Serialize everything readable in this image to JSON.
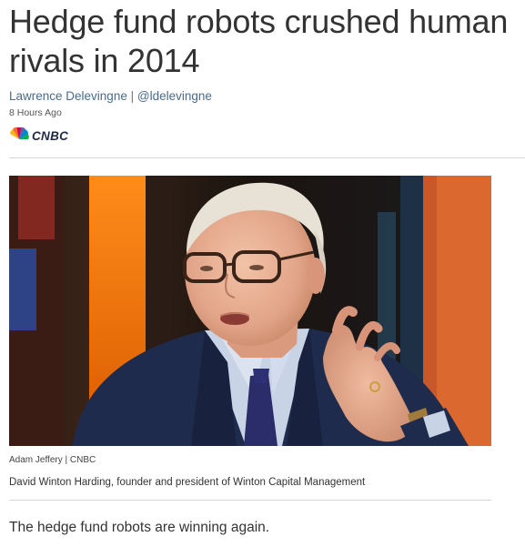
{
  "article": {
    "headline": "Hedge fund robots crushed human rivals in 2014",
    "byline": {
      "author": "Lawrence Delevingne",
      "separator": "|",
      "handle": "@ldelevingne"
    },
    "timestamp": "8 Hours Ago",
    "publisher_logo": {
      "icon": "nbc-peacock-icon",
      "wordmark": "CNBC"
    },
    "photo": {
      "credit": "Adam Jeffery | CNBC",
      "caption": "David Winton Harding, founder and president of Winton Capital Management"
    },
    "lede": "The hedge fund robots are winning again."
  }
}
